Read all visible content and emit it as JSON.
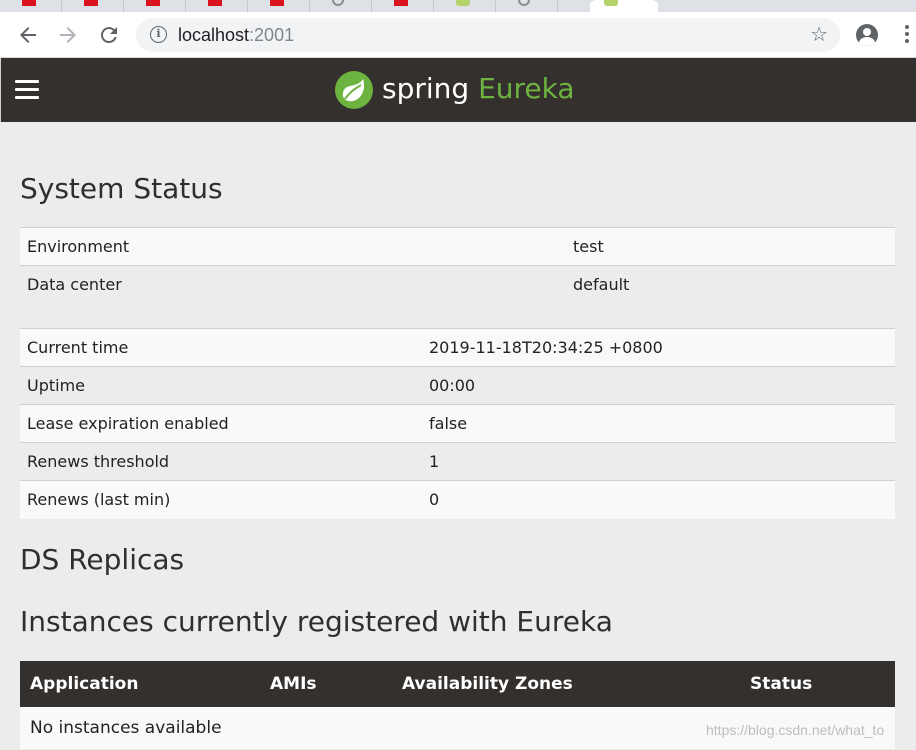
{
  "browser": {
    "url_host": "localhost",
    "url_port": ":2001"
  },
  "header": {
    "brand_spring": "spring",
    "brand_eureka": "Eureka"
  },
  "system_status": {
    "title": "System Status",
    "env_rows": [
      {
        "label": "Environment",
        "value": "test"
      },
      {
        "label": "Data center",
        "value": "default"
      }
    ],
    "runtime_rows": [
      {
        "label": "Current time",
        "value": "2019-11-18T20:34:25 +0800"
      },
      {
        "label": "Uptime",
        "value": "00:00"
      },
      {
        "label": "Lease expiration enabled",
        "value": "false"
      },
      {
        "label": "Renews threshold",
        "value": "1"
      },
      {
        "label": "Renews (last min)",
        "value": "0"
      }
    ]
  },
  "ds_replicas": {
    "title": "DS Replicas"
  },
  "instances": {
    "title": "Instances currently registered with Eureka",
    "columns": [
      "Application",
      "AMIs",
      "Availability Zones",
      "Status"
    ],
    "empty_message": "No instances available"
  },
  "watermark": "https://blog.csdn.net/what_to",
  "colors": {
    "header_bg": "#34302d",
    "spring_green": "#6db33f",
    "page_bg": "#ececec"
  }
}
